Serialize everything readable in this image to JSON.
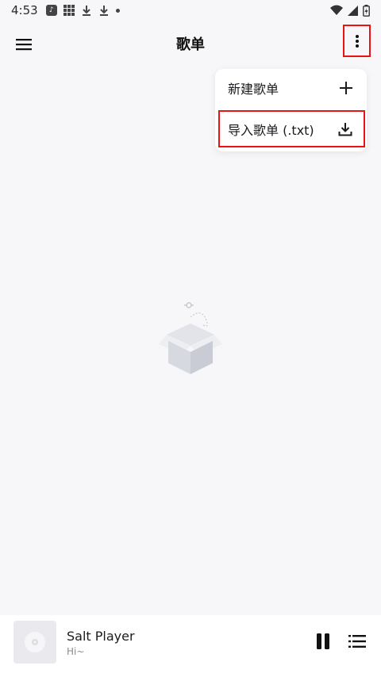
{
  "status_bar": {
    "time": "4:53",
    "icons": [
      "app-notification-icon",
      "grid-icon",
      "download-icon",
      "download-icon",
      "dot-icon",
      "wifi-icon",
      "signal-icon",
      "battery-icon"
    ]
  },
  "app_bar": {
    "title": "歌单",
    "menu_icon": "hamburger-menu-icon",
    "more_icon": "more-vertical-icon"
  },
  "dropdown_menu": {
    "items": [
      {
        "label": "新建歌单",
        "icon": "plus-icon"
      },
      {
        "label": "导入歌单 (.txt)",
        "icon": "download-icon"
      }
    ]
  },
  "empty_state": {
    "icon": "empty-box-icon"
  },
  "now_playing": {
    "title": "Salt Player",
    "subtitle": "Hi~",
    "pause_icon": "pause-icon",
    "queue_icon": "playlist-icon"
  },
  "colors": {
    "background": "#f7f7fa",
    "highlight": "#ee1111",
    "player_bar": "#ffffff"
  }
}
